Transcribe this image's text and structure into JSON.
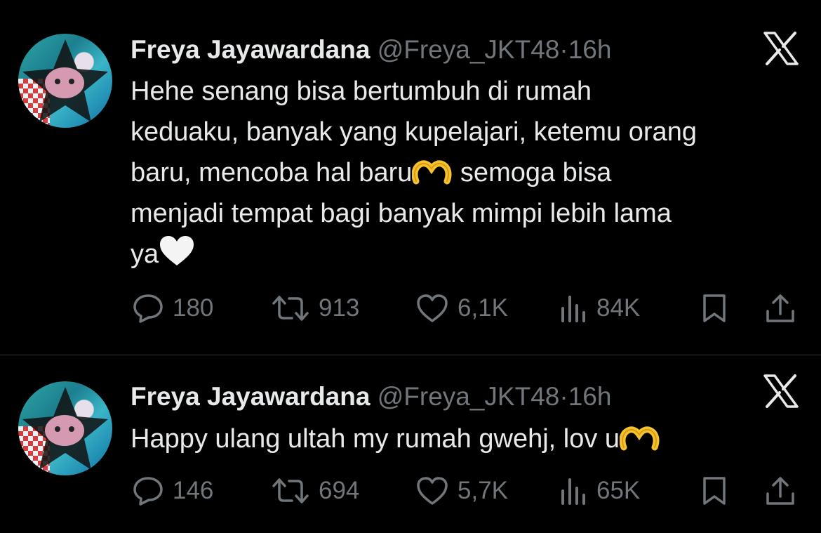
{
  "tweets": [
    {
      "author": {
        "display_name": "Freya Jayawardana",
        "handle": "@Freya_JKT48",
        "time": "16h"
      },
      "body": {
        "line1": "Hehe senang bisa bertumbuh di rumah",
        "line2": "keduaku, banyak yang kupelajari, ketemu orang",
        "line3_before_emoji": "baru, mencoba hal baru",
        "line3_after_emoji": " semoga bisa",
        "line4": "menjadi tempat bagi banyak mimpi lebih lama",
        "line5": "ya"
      },
      "stats": {
        "replies": "180",
        "reposts": "913",
        "likes": "6,1K",
        "views": "84K"
      }
    },
    {
      "author": {
        "display_name": "Freya Jayawardana",
        "handle": "@Freya_JKT48",
        "time": "16h"
      },
      "body": {
        "text": "Happy ulang ultah my rumah gwehj, lov u"
      },
      "stats": {
        "replies": "146",
        "reposts": "694",
        "likes": "5,7K",
        "views": "65K"
      }
    }
  ],
  "colors": {
    "background": "#000000",
    "text": "#e7e9ea",
    "muted": "#71767b",
    "divider": "#2f3336"
  },
  "icons": [
    "x-logo-icon",
    "reply-icon",
    "repost-icon",
    "like-icon",
    "views-icon",
    "bookmark-icon",
    "share-icon",
    "heart-hands-emoji",
    "white-heart-emoji"
  ]
}
